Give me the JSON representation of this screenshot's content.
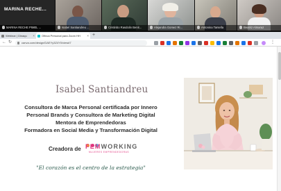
{
  "meeting": {
    "presenter_tile_name": "MARINA RECHE...",
    "participants": [
      {
        "label": "MARINA RECHE PIMEL ..."
      },
      {
        "label": "Isabel Santiandreu ..."
      },
      {
        "label": "Cristinbo Rasdolin Benit..."
      },
      {
        "label": "Alejandra Gomez Ri..."
      },
      {
        "label": "Antonina Tarsella"
      },
      {
        "label": "Beatriz Almaraz"
      }
    ]
  },
  "browser": {
    "tabs": [
      {
        "label": "Webinar | Dinaqu"
      },
      {
        "label": "Ofinca Personal para Zoom HH"
      }
    ],
    "new_tab_symbol": "+",
    "url": "canva.com/design/DAEYy3Z4Y0/view#7"
  },
  "slide": {
    "name": "Isabel Santiandreu",
    "lines": [
      "Consultora de Marca Personal certificada por Innero",
      "Personal Brands y Consultora de Marketing Digital",
      "Mentora de Emprendedoras",
      "Formadora en Social Media y Transformación Digital"
    ],
    "creadora_label": "Creadora de",
    "logo_part_1": "FEM",
    "logo_part_2": "WORKING",
    "logo_tagline": "MUJERES EMPRENDEDORAS",
    "quote": "\"El corazón es el centro de la estrategia\""
  },
  "colors": {
    "name": "#7a6a6f",
    "quote": "#2a5a4c",
    "brand_pink": "#e0347d",
    "brand_gray": "#5f5f5f",
    "dot_orange": "#f29b38",
    "dot_pink": "#e0347d",
    "dot_blue": "#5fa8d9"
  }
}
